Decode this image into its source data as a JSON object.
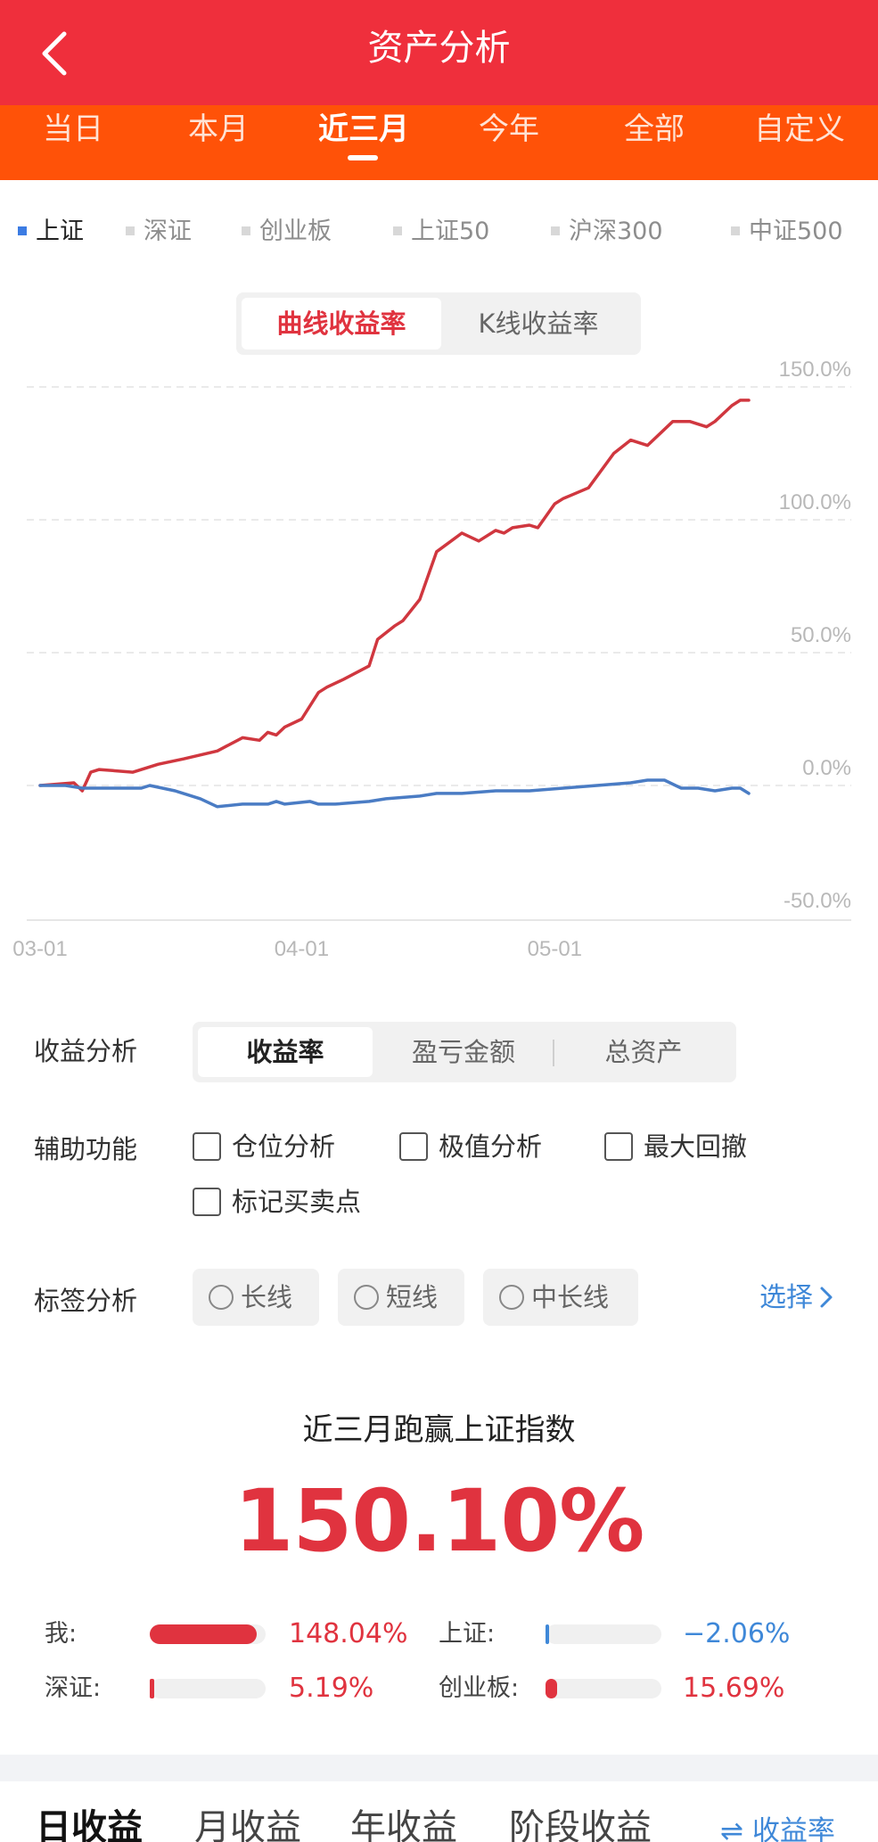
{
  "header": {
    "title": "资产分析"
  },
  "period_tabs": [
    {
      "label": "当日",
      "active": false
    },
    {
      "label": "本月",
      "active": false
    },
    {
      "label": "近三月",
      "active": true
    },
    {
      "label": "今年",
      "active": false
    },
    {
      "label": "全部",
      "active": false
    },
    {
      "label": "自定义",
      "active": false
    }
  ],
  "index_options": [
    {
      "label": "上证",
      "active": true
    },
    {
      "label": "深证",
      "active": false
    },
    {
      "label": "创业板",
      "active": false
    },
    {
      "label": "上证50",
      "active": false
    },
    {
      "label": "沪深300",
      "active": false
    },
    {
      "label": "中证500",
      "active": false
    }
  ],
  "chart_mode": {
    "options": [
      "曲线收益率",
      "K线收益率"
    ],
    "selected": "曲线收益率"
  },
  "colors": {
    "brand_red": "#ef2f3c",
    "tab_orange": "#ff5208",
    "my_series": "#d0373f",
    "index_series": "#4a7cc4",
    "positive": "#e0333f",
    "negative": "#3f88d8"
  },
  "chart_data": {
    "type": "line",
    "x_tick_labels": [
      "03-01",
      "04-01",
      "05-01"
    ],
    "y_tick_labels": [
      "150.0%",
      "100.0%",
      "50.0%",
      "0.0%",
      "-50.0%"
    ],
    "ylim": [
      -50,
      150
    ],
    "x_range": [
      "03-01",
      "05-24"
    ],
    "grid": true,
    "series": [
      {
        "color": "#d0373f",
        "x": [
          "03-01",
          "03-05",
          "03-06",
          "03-07",
          "03-08",
          "03-12",
          "03-15",
          "03-18",
          "03-22",
          "03-25",
          "03-27",
          "03-28",
          "03-29",
          "03-30",
          "04-01",
          "04-03",
          "04-04",
          "04-06",
          "04-09",
          "04-10",
          "04-12",
          "04-13",
          "04-15",
          "04-17",
          "04-20",
          "04-22",
          "04-24",
          "04-25",
          "04-26",
          "04-28",
          "04-29",
          "05-01",
          "05-02",
          "05-05",
          "05-08",
          "05-10",
          "05-12",
          "05-15",
          "05-17",
          "05-18",
          "05-19",
          "05-20",
          "05-22",
          "05-23",
          "05-24"
        ],
        "values": [
          0,
          1,
          -2,
          5,
          6,
          5,
          8,
          10,
          13,
          18,
          17,
          20,
          19,
          22,
          25,
          35,
          37,
          40,
          45,
          55,
          60,
          62,
          70,
          88,
          95,
          92,
          96,
          95,
          97,
          98,
          97,
          106,
          108,
          112,
          125,
          130,
          128,
          137,
          137,
          136,
          135,
          137,
          143,
          145,
          145
        ]
      },
      {
        "color": "#4a7cc4",
        "x": [
          "03-01",
          "03-04",
          "03-06",
          "03-07",
          "03-10",
          "03-13",
          "03-14",
          "03-17",
          "03-20",
          "03-22",
          "03-25",
          "03-28",
          "03-29",
          "03-30",
          "04-02",
          "04-03",
          "04-05",
          "04-09",
          "04-11",
          "04-15",
          "04-17",
          "04-20",
          "04-24",
          "04-28",
          "05-02",
          "05-06",
          "05-10",
          "05-12",
          "05-13",
          "05-14",
          "05-16",
          "05-18",
          "05-20",
          "05-22",
          "05-23",
          "05-24"
        ],
        "values": [
          0,
          0,
          -1,
          -1,
          -1,
          -1,
          0,
          -2,
          -5,
          -8,
          -7,
          -7,
          -6,
          -7,
          -6,
          -7,
          -7,
          -6,
          -5,
          -4,
          -3,
          -3,
          -2,
          -2,
          -1,
          0,
          1,
          2,
          2,
          2,
          -1,
          -1,
          -2,
          -1,
          -1,
          -3
        ]
      }
    ]
  },
  "profit_analysis": {
    "label": "收益分析",
    "options": [
      "收益率",
      "盈亏金额",
      "总资产"
    ],
    "selected": "收益率"
  },
  "aux_functions": {
    "label": "辅助功能",
    "items": [
      {
        "label": "仓位分析",
        "checked": false
      },
      {
        "label": "极值分析",
        "checked": false
      },
      {
        "label": "最大回撤",
        "checked": false
      },
      {
        "label": "标记买卖点",
        "checked": false
      }
    ]
  },
  "tag_analysis": {
    "label": "标签分析",
    "tags": [
      "长线",
      "短线",
      "中长线"
    ],
    "choose_label": "选择"
  },
  "beat": {
    "title": "近三月跑赢上证指数",
    "value": "150.10%"
  },
  "comparisons": [
    {
      "label": "我:",
      "value": "148.04%",
      "fill": 0.92,
      "sign": "positive"
    },
    {
      "label": "上证:",
      "value": "−2.06%",
      "fill": 0.02,
      "sign": "negative"
    },
    {
      "label": "深证:",
      "value": "5.19%",
      "fill": 0.035,
      "sign": "positive"
    },
    {
      "label": "创业板:",
      "value": "15.69%",
      "fill": 0.1,
      "sign": "positive"
    }
  ],
  "bottom_tabs": {
    "items": [
      "日收益",
      "月收益",
      "年收益",
      "阶段收益"
    ],
    "active": "日收益",
    "toggle_label": "⇌ 收益率"
  }
}
